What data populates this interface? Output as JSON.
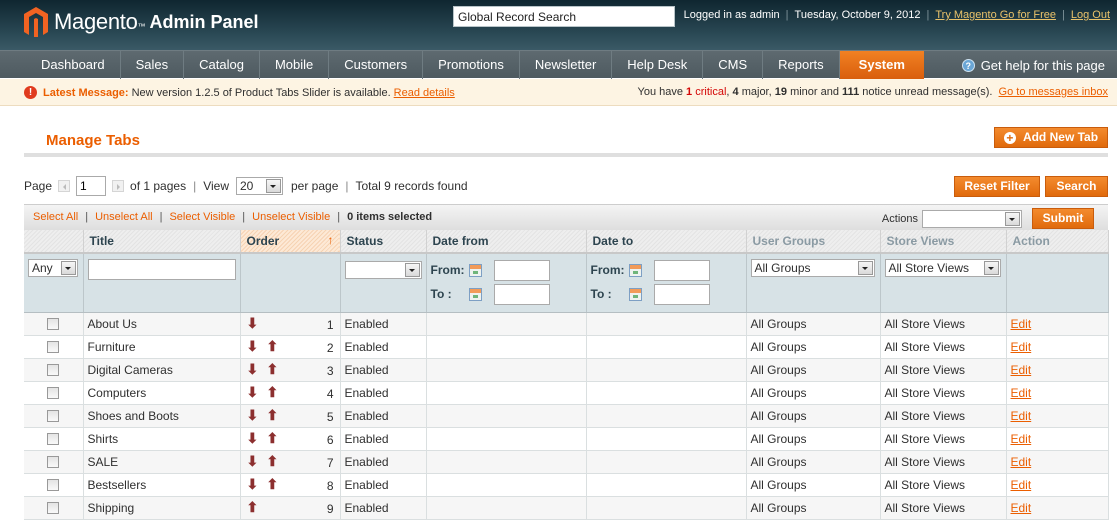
{
  "header": {
    "brand": "Magento",
    "brand_suffix": "Admin Panel",
    "global_search_value": "Global Record Search",
    "logged_in": "Logged in as admin",
    "date": "Tuesday, October 9, 2012",
    "try_link": "Try Magento Go for Free",
    "logout": "Log Out"
  },
  "nav": {
    "items": [
      "Dashboard",
      "Sales",
      "Catalog",
      "Mobile",
      "Customers",
      "Promotions",
      "Newsletter",
      "Help Desk",
      "CMS",
      "Reports",
      "System"
    ],
    "active": "System",
    "help": "Get help for this page"
  },
  "message": {
    "label": "Latest Message:",
    "text": "New version 1.2.5 of Product Tabs Slider is available.",
    "link": "Read details",
    "right_prefix": "You have",
    "critical_count": "1",
    "critical_word": "critical",
    "major_count": "4",
    "major_word": "major,",
    "minor_count": "19",
    "minor_word": "minor and",
    "notice_count": "111",
    "notice_word": "notice unread message(s).",
    "inbox_link": "Go to messages inbox"
  },
  "page": {
    "title": "Manage Tabs",
    "add_button": "Add New Tab"
  },
  "pager": {
    "page_label": "Page",
    "page_value": "1",
    "of_pages": "of 1 pages",
    "view_label": "View",
    "per_page_value": "20",
    "per_page_label": "per page",
    "total": "Total 9 records found",
    "reset_filter": "Reset Filter",
    "search": "Search"
  },
  "massaction": {
    "select_all": "Select All",
    "unselect_all": "Unselect All",
    "select_visible": "Select Visible",
    "unselect_visible": "Unselect Visible",
    "selected": "0 items selected",
    "actions_label": "Actions",
    "actions_value": "",
    "submit": "Submit"
  },
  "grid": {
    "columns": [
      "",
      "Title",
      "Order",
      "Status",
      "Date from",
      "Date to",
      "User Groups",
      "Store Views",
      "Action"
    ],
    "filters": {
      "massaction_value": "Any",
      "title_value": "",
      "status_value": "",
      "from_label": "From:",
      "to_label": "To :",
      "user_groups_value": "All Groups",
      "store_views_value": "All Store Views"
    },
    "rows": [
      {
        "title": "About Us",
        "order": "1",
        "status": "Enabled",
        "date_from": "",
        "date_to": "",
        "groups": "All Groups",
        "stores": "All Store Views",
        "action": "Edit",
        "down": true,
        "up": false
      },
      {
        "title": "Furniture",
        "order": "2",
        "status": "Enabled",
        "date_from": "",
        "date_to": "",
        "groups": "All Groups",
        "stores": "All Store Views",
        "action": "Edit",
        "down": true,
        "up": true
      },
      {
        "title": "Digital Cameras",
        "order": "3",
        "status": "Enabled",
        "date_from": "",
        "date_to": "",
        "groups": "All Groups",
        "stores": "All Store Views",
        "action": "Edit",
        "down": true,
        "up": true
      },
      {
        "title": "Computers",
        "order": "4",
        "status": "Enabled",
        "date_from": "",
        "date_to": "",
        "groups": "All Groups",
        "stores": "All Store Views",
        "action": "Edit",
        "down": true,
        "up": true
      },
      {
        "title": "Shoes and Boots",
        "order": "5",
        "status": "Enabled",
        "date_from": "",
        "date_to": "",
        "groups": "All Groups",
        "stores": "All Store Views",
        "action": "Edit",
        "down": true,
        "up": true
      },
      {
        "title": "Shirts",
        "order": "6",
        "status": "Enabled",
        "date_from": "",
        "date_to": "",
        "groups": "All Groups",
        "stores": "All Store Views",
        "action": "Edit",
        "down": true,
        "up": true
      },
      {
        "title": "SALE",
        "order": "7",
        "status": "Enabled",
        "date_from": "",
        "date_to": "",
        "groups": "All Groups",
        "stores": "All Store Views",
        "action": "Edit",
        "down": true,
        "up": true
      },
      {
        "title": "Bestsellers",
        "order": "8",
        "status": "Enabled",
        "date_from": "",
        "date_to": "",
        "groups": "All Groups",
        "stores": "All Store Views",
        "action": "Edit",
        "down": true,
        "up": true
      },
      {
        "title": "Shipping",
        "order": "9",
        "status": "Enabled",
        "date_from": "",
        "date_to": "",
        "groups": "All Groups",
        "stores": "All Store Views",
        "action": "Edit",
        "down": false,
        "up": true
      }
    ]
  },
  "colors": {
    "accent": "#eb5e00",
    "header_bg": "#2b4a56",
    "nav_bg": "#566268",
    "arrow": "#8c2f2f",
    "critical": "#d40707"
  }
}
